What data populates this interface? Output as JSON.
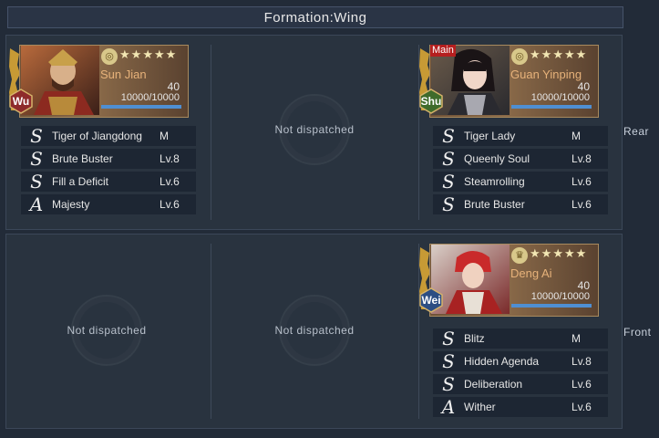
{
  "title": "Formation:Wing",
  "rows": {
    "rear": "Rear",
    "front": "Front"
  },
  "empty_label": "Not dispatched",
  "generals": {
    "sun_jian": {
      "name": "Sun Jian",
      "faction": "Wu",
      "faction_color": "#8e2b2b",
      "stars": 5,
      "level": "40",
      "troops": "10000/10000",
      "troop_fill": 1.0,
      "main": false,
      "grade_badge": "",
      "skills": [
        {
          "grade": "S",
          "name": "Tiger of Jiangdong",
          "level": "M"
        },
        {
          "grade": "S",
          "name": "Brute Buster",
          "level": "Lv.8"
        },
        {
          "grade": "S",
          "name": "Fill a Deficit",
          "level": "Lv.6"
        },
        {
          "grade": "A",
          "name": "Majesty",
          "level": "Lv.6"
        }
      ]
    },
    "guan_yinping": {
      "name": "Guan Yinping",
      "faction": "Shu",
      "faction_color": "#3f6b2b",
      "stars": 5,
      "level": "40",
      "troops": "10000/10000",
      "troop_fill": 1.0,
      "main": true,
      "main_label": "Main",
      "grade_badge": "",
      "skills": [
        {
          "grade": "S",
          "name": "Tiger Lady",
          "level": "M"
        },
        {
          "grade": "S",
          "name": "Queenly Soul",
          "level": "Lv.8"
        },
        {
          "grade": "S",
          "name": "Steamrolling",
          "level": "Lv.6"
        },
        {
          "grade": "S",
          "name": "Brute Buster",
          "level": "Lv.6"
        }
      ]
    },
    "deng_ai": {
      "name": "Deng Ai",
      "faction": "Wei",
      "faction_color": "#2d4e83",
      "stars": 5,
      "level": "40",
      "troops": "10000/10000",
      "troop_fill": 1.0,
      "main": false,
      "grade_badge": "",
      "skills": [
        {
          "grade": "S",
          "name": "Blitz",
          "level": "M"
        },
        {
          "grade": "S",
          "name": "Hidden Agenda",
          "level": "Lv.8"
        },
        {
          "grade": "S",
          "name": "Deliberation",
          "level": "Lv.6"
        },
        {
          "grade": "A",
          "name": "Wither",
          "level": "Lv.6"
        }
      ]
    }
  }
}
